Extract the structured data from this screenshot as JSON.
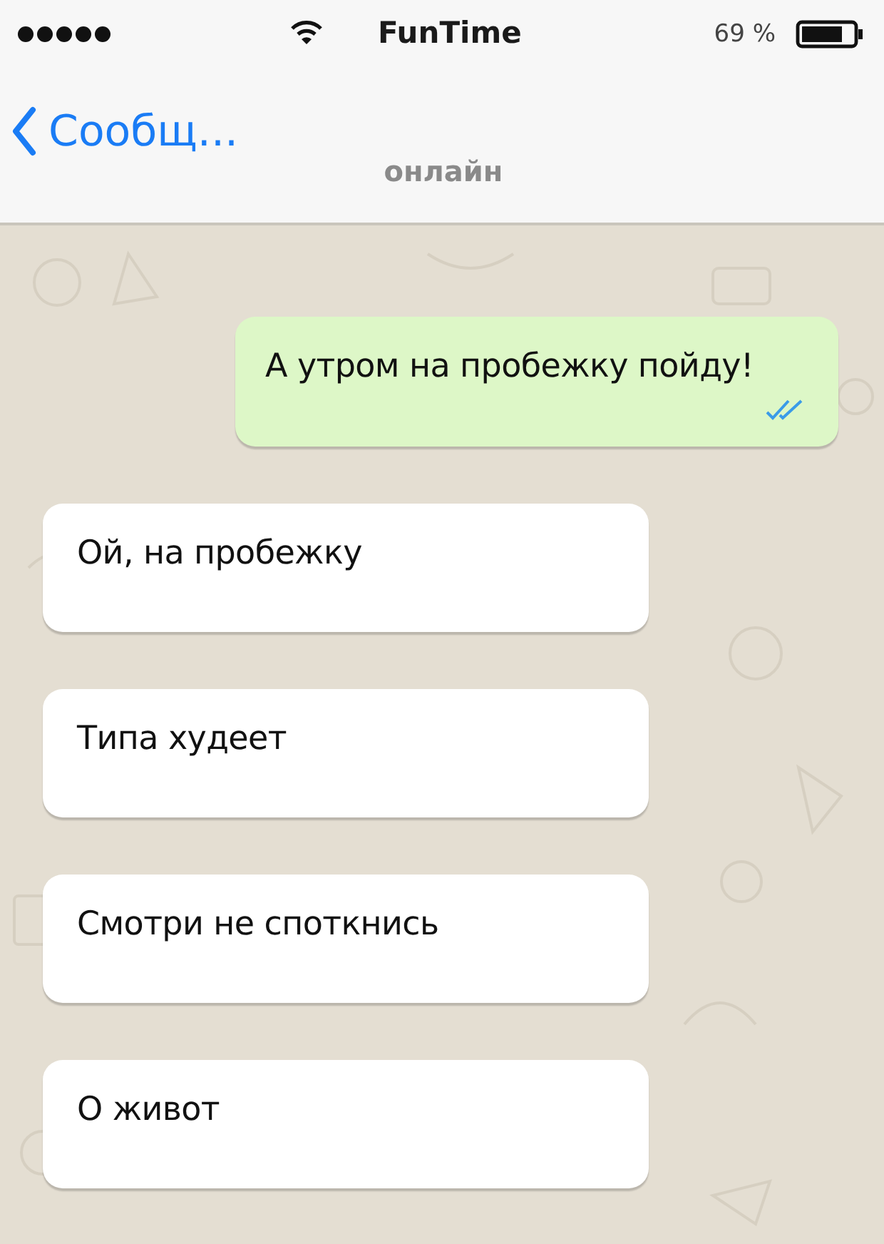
{
  "status_bar": {
    "carrier": "FunTime",
    "battery": "69 %"
  },
  "nav": {
    "back": "Сообщ...",
    "subtitle": "онлайн"
  },
  "messages": [
    {
      "kind": "outgoing",
      "text": "А утром на пробежку пойду!",
      "read": true
    },
    {
      "kind": "incoming",
      "text": "Ой, на пробежку"
    },
    {
      "kind": "incoming",
      "text": "Типа худеет"
    },
    {
      "kind": "incoming",
      "text": "Смотри не споткнись"
    },
    {
      "kind": "incoming",
      "text": "О живот"
    }
  ]
}
